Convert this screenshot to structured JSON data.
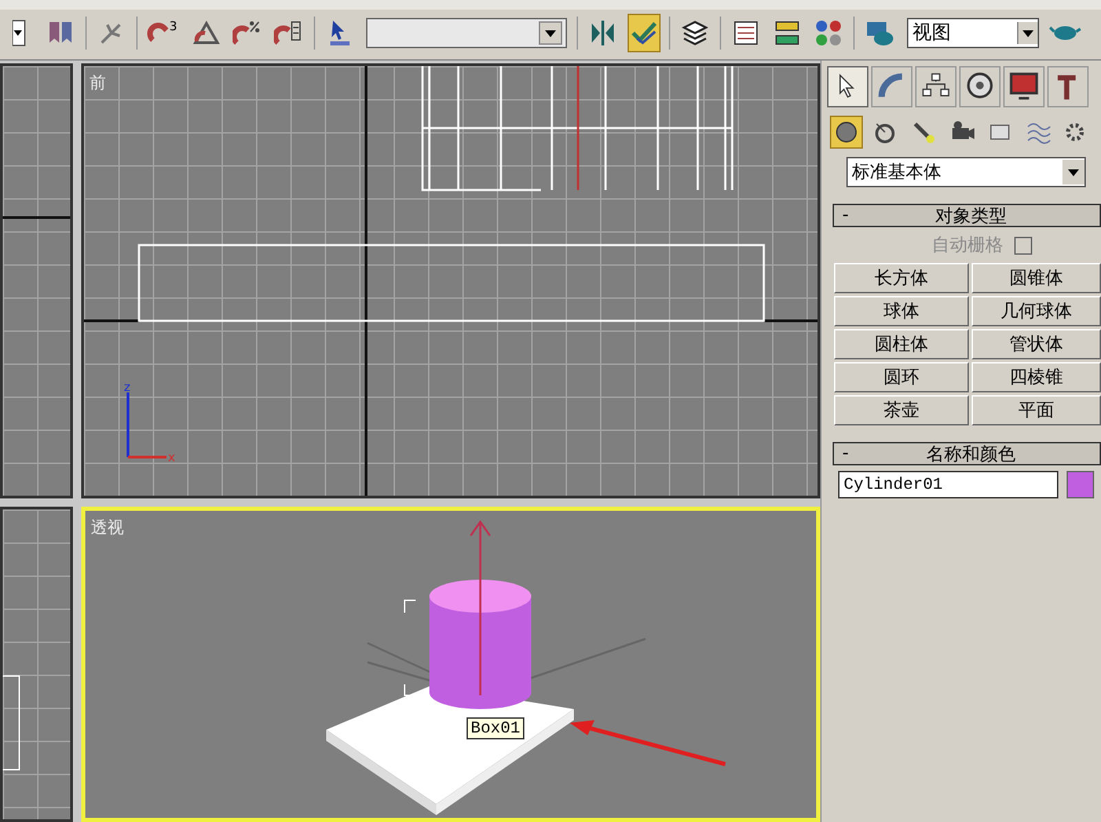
{
  "toolbar": {
    "buttons": [
      {
        "kind": "dropdown-stub",
        "active": false
      },
      {
        "kind": "bookmark",
        "active": false
      },
      {
        "kind": "snap",
        "active": false
      },
      {
        "kind": "magnet",
        "active": false,
        "badge": "3"
      },
      {
        "kind": "angle",
        "active": false
      },
      {
        "kind": "percent",
        "active": false
      },
      {
        "kind": "spinner",
        "active": false
      },
      {
        "kind": "cursor",
        "active": false
      },
      {
        "kind": "selection-set",
        "active": false
      },
      {
        "kind": "mirror",
        "active": false
      },
      {
        "kind": "align",
        "active": true
      },
      {
        "kind": "layers",
        "active": false
      },
      {
        "kind": "curve",
        "active": false
      },
      {
        "kind": "schematic",
        "active": false
      },
      {
        "kind": "material",
        "active": false
      },
      {
        "kind": "render-scene",
        "active": false
      },
      {
        "kind": "view-dropdown",
        "active": false
      },
      {
        "kind": "teapot",
        "active": false
      }
    ],
    "view_dropdown": "视图"
  },
  "viewports": [
    {
      "kind": "front",
      "label": "前",
      "active": false,
      "axis_labels": [
        "z",
        "x"
      ]
    },
    {
      "kind": "perspective",
      "label": "透视",
      "active": true,
      "tooltip": "Box01"
    }
  ],
  "command_panel": {
    "tabs": [
      {
        "kind": "create",
        "selected": true
      },
      {
        "kind": "modify",
        "selected": false
      },
      {
        "kind": "hierarchy",
        "selected": false
      },
      {
        "kind": "motion",
        "selected": false
      },
      {
        "kind": "display",
        "selected": false
      },
      {
        "kind": "utilities",
        "selected": false
      }
    ],
    "categories": [
      {
        "kind": "geometry",
        "selected": true
      },
      {
        "kind": "shapes",
        "selected": false
      },
      {
        "kind": "lights",
        "selected": false
      },
      {
        "kind": "cameras",
        "selected": false
      },
      {
        "kind": "helpers",
        "selected": false
      },
      {
        "kind": "spacewarps",
        "selected": false
      },
      {
        "kind": "systems",
        "selected": false
      }
    ],
    "category_dropdown": "标准基本体",
    "rollouts": [
      {
        "kind": "object-type",
        "sign": "-",
        "title": "对象类型",
        "auto_grid": {
          "label": "自动栅格",
          "checked": false,
          "disabled": true
        },
        "buttons": [
          "长方体",
          "圆锥体",
          "球体",
          "几何球体",
          "圆柱体",
          "管状体",
          "圆环",
          "四棱锥",
          "茶壶",
          "平面"
        ]
      },
      {
        "kind": "name-color",
        "sign": "-",
        "title": "名称和颜色",
        "name": "Cylinder01",
        "color": "#c060e0"
      }
    ]
  }
}
